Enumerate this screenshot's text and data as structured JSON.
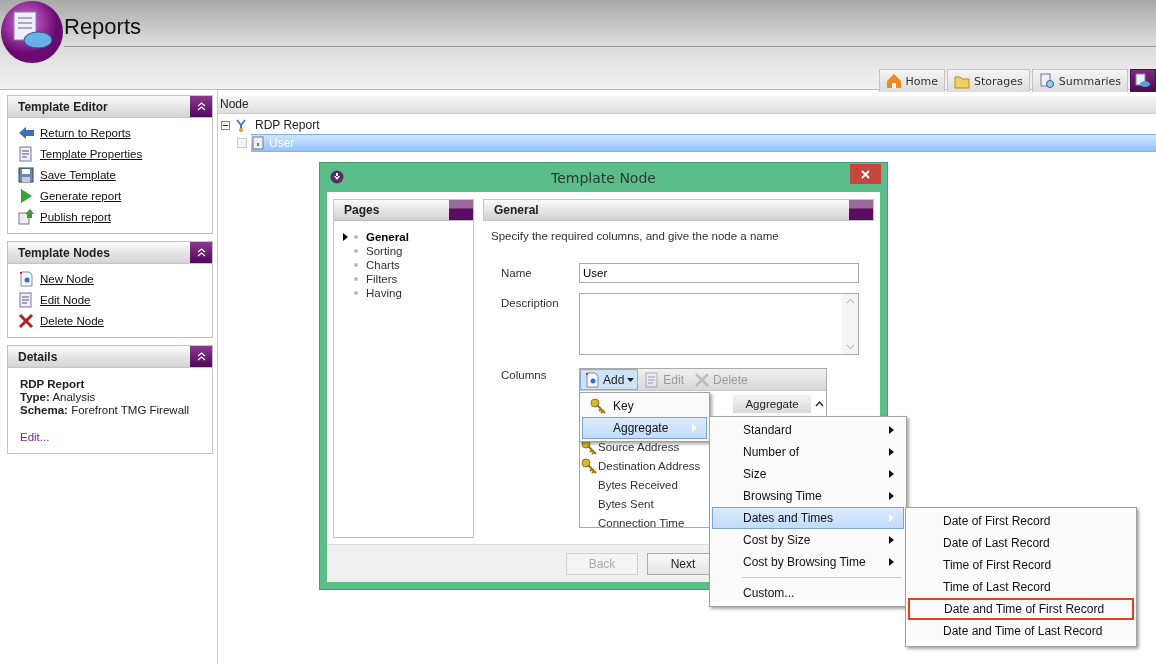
{
  "app": {
    "title": "Reports"
  },
  "tabs": [
    {
      "label": "Home",
      "selected": false
    },
    {
      "label": "Storages",
      "selected": false
    },
    {
      "label": "Summaries",
      "selected": false
    },
    {
      "selected": true
    }
  ],
  "sidebar": {
    "panels": [
      {
        "kind": "links",
        "title": "Template Editor",
        "items": [
          "Return to Reports",
          "Template Properties",
          "Save Template",
          "Generate report",
          "Publish report"
        ]
      },
      {
        "kind": "links",
        "title": "Template Nodes",
        "items": [
          "New Node",
          "Edit Node",
          "Delete Node"
        ]
      },
      {
        "kind": "details",
        "title": "Details",
        "heading": "RDP Report",
        "fields": [
          "**Type:** Analysis",
          "**Schema:** Forefront TMG Firewall"
        ],
        "link": "Edit..."
      }
    ]
  },
  "tree": {
    "column": "Node",
    "items": [
      {
        "label": "RDP Report",
        "expanded": true,
        "selected": false,
        "children": [
          {
            "label": "User",
            "selected": true,
            "checked": false
          }
        ]
      }
    ]
  },
  "dialog": {
    "title": "Template Node",
    "pages": {
      "title": "Pages",
      "items": [
        {
          "label": "General",
          "selected": true
        },
        {
          "label": "Sorting",
          "selected": false
        },
        {
          "label": "Charts",
          "selected": false
        },
        {
          "label": "Filters",
          "selected": false
        },
        {
          "label": "Having",
          "selected": false
        }
      ]
    },
    "general": {
      "title": "General",
      "instruction": "Specify the required columns, and give the node a name",
      "name_label": "Name",
      "name_value": "User",
      "description_label": "Description",
      "columns_label": "Columns",
      "toolbar": [
        {
          "label": "Add",
          "disabled": false
        },
        {
          "label": "Edit",
          "disabled": true
        },
        {
          "label": "Delete",
          "disabled": true
        }
      ],
      "column_header": "Aggregate",
      "rows": [
        {
          "label": "Source Address",
          "key": true
        },
        {
          "label": "Destination Address",
          "key": true
        },
        {
          "label": "Bytes Received",
          "key": false
        },
        {
          "label": "Bytes Sent",
          "key": false
        },
        {
          "label": "Connection Time",
          "key": false
        }
      ]
    },
    "buttons": [
      {
        "label": "Back",
        "disabled": true
      },
      {
        "label": "Next",
        "disabled": false
      }
    ]
  },
  "add_menu": [
    {
      "label": "Key",
      "selected": false,
      "submenu": false
    },
    {
      "label": "Aggregate",
      "selected": true,
      "submenu": true
    }
  ],
  "aggregate_menu": [
    {
      "kind": "item",
      "label": "Standard",
      "selected": false
    },
    {
      "kind": "item",
      "label": "Number of",
      "selected": false
    },
    {
      "kind": "item",
      "label": "Size",
      "selected": false
    },
    {
      "kind": "item",
      "label": "Browsing Time",
      "selected": false
    },
    {
      "kind": "item",
      "label": "Dates and Times",
      "selected": true
    },
    {
      "kind": "item",
      "label": "Cost by Size",
      "selected": false
    },
    {
      "kind": "item",
      "label": "Cost by Browsing Time",
      "selected": false
    },
    {
      "kind": "separator"
    },
    {
      "kind": "leaf",
      "label": "Custom...",
      "selected": false
    }
  ],
  "dates_menu": [
    {
      "label": "Date of First Record",
      "outlined": false
    },
    {
      "label": "Date of Last Record",
      "outlined": false
    },
    {
      "label": "Time of First Record",
      "outlined": false
    },
    {
      "label": "Time of Last Record",
      "outlined": false
    },
    {
      "label": "Date and Time of First Record",
      "outlined": true
    },
    {
      "label": "Date and Time of Last Record",
      "outlined": false
    }
  ]
}
